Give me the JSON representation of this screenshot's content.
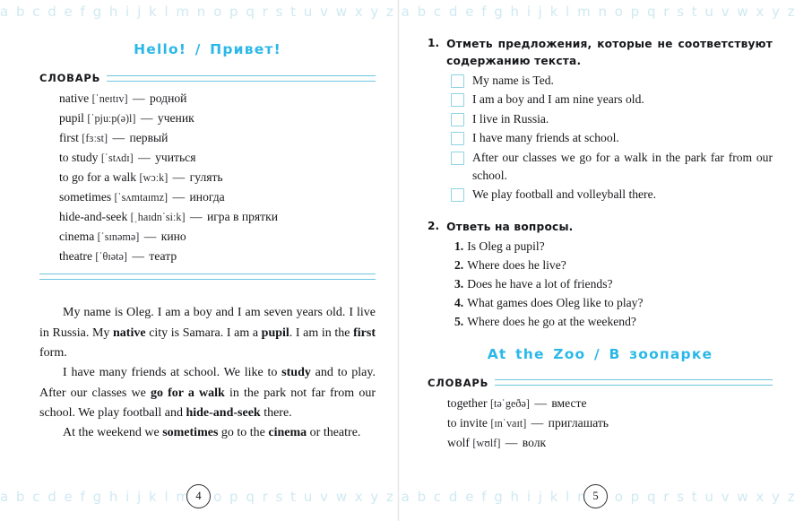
{
  "decor": {
    "alphabet_band": "a b c d e f g h i j k l m n o p q r s t u v w x y z a b c d e f g h i j k l m n o p q r s t u v w x y z"
  },
  "left_page": {
    "title": "Hello!  /  Привет!",
    "vocabulary": {
      "heading": "СЛОВАРЬ",
      "entries": [
        {
          "word": "native",
          "ipa": "[ˈneɪtɪv]",
          "dash": "—",
          "translation": "родной"
        },
        {
          "word": "pupil",
          "ipa": "[ˈpjuːp(ə)l]",
          "dash": "—",
          "translation": "ученик"
        },
        {
          "word": "first",
          "ipa": "[fɜːst]",
          "dash": "—",
          "translation": "первый"
        },
        {
          "word": "to study",
          "ipa": "[ˈstʌdɪ]",
          "dash": "—",
          "translation": "учиться"
        },
        {
          "word": "to go for a walk",
          "ipa": "[wɔːk]",
          "dash": "—",
          "translation": "гулять"
        },
        {
          "word": "sometimes",
          "ipa": "[ˈsʌmtaɪmz]",
          "dash": "—",
          "translation": "иногда"
        },
        {
          "word": "hide-and-seek",
          "ipa": "[ˌhaɪdnˈsiːk]",
          "dash": "—",
          "translation": "игра в прятки"
        },
        {
          "word": "cinema",
          "ipa": "[ˈsɪnəmə]",
          "dash": "—",
          "translation": "кино"
        },
        {
          "word": "theatre",
          "ipa": "[ˈθɪətə]",
          "dash": "—",
          "translation": "театр"
        }
      ]
    },
    "reading": {
      "paragraph_1": [
        {
          "text": "My name is Oleg. I am a boy and I am seven years old. I live in Russia. My ",
          "bold": false
        },
        {
          "text": "native",
          "bold": true
        },
        {
          "text": " city is Samara. I am a ",
          "bold": false
        },
        {
          "text": "pupil",
          "bold": true
        },
        {
          "text": ". I am in the ",
          "bold": false
        },
        {
          "text": "first",
          "bold": true
        },
        {
          "text": " form.",
          "bold": false
        }
      ],
      "paragraph_2": [
        {
          "text": "I have many friends at school. We like to ",
          "bold": false
        },
        {
          "text": "study",
          "bold": true
        },
        {
          "text": " and to play. After our classes we ",
          "bold": false
        },
        {
          "text": "go for a walk",
          "bold": true
        },
        {
          "text": " in the park not far from our school. We play football and ",
          "bold": false
        },
        {
          "text": "hide-and-seek",
          "bold": true
        },
        {
          "text": " there.",
          "bold": false
        }
      ],
      "paragraph_3": [
        {
          "text": "At the weekend we ",
          "bold": false
        },
        {
          "text": "sometimes",
          "bold": true
        },
        {
          "text": " go to the ",
          "bold": false
        },
        {
          "text": "cinema",
          "bold": true
        },
        {
          "text": " or theatre.",
          "bold": false
        }
      ]
    },
    "page_number": "4"
  },
  "right_page": {
    "exercise_1": {
      "number": "1.",
      "instruction": "Отметь предложения, которые не соответствуют содержанию текста.",
      "items": [
        "My name is Ted.",
        "I am a boy and I am nine years old.",
        "I live in Russia.",
        "I have many friends at school.",
        "After our classes we go for a walk in the park far from our school.",
        "We play football and volleyball there."
      ]
    },
    "exercise_2": {
      "number": "2.",
      "instruction": "Ответь на вопросы.",
      "questions": [
        {
          "num": "1.",
          "text": "Is Oleg a pupil?"
        },
        {
          "num": "2.",
          "text": "Where does he live?"
        },
        {
          "num": "3.",
          "text": "Does he have a lot of friends?"
        },
        {
          "num": "4.",
          "text": "What games does Oleg like to play?"
        },
        {
          "num": "5.",
          "text": "Where does he go at the weekend?"
        }
      ]
    },
    "zoo_section": {
      "title": "At the Zoo  /  В зоопарке",
      "vocabulary": {
        "heading": "СЛОВАРЬ",
        "entries": [
          {
            "word": "together",
            "ipa": "[təˈgeðə]",
            "dash": "—",
            "translation": "вместе"
          },
          {
            "word": "to invite",
            "ipa": "[ɪnˈvaɪt]",
            "dash": "—",
            "translation": "приглашать"
          },
          {
            "word": "wolf",
            "ipa": "[wʊlf]",
            "dash": "—",
            "translation": "волк"
          }
        ]
      }
    },
    "page_number": "5"
  },
  "colors": {
    "accent_cyan": "#2bb8e8",
    "rule_cyan": "#6ec6de",
    "checkbox_border": "#8ed3e2",
    "decor_band": "#bfe2ee",
    "text": "#17181b"
  }
}
